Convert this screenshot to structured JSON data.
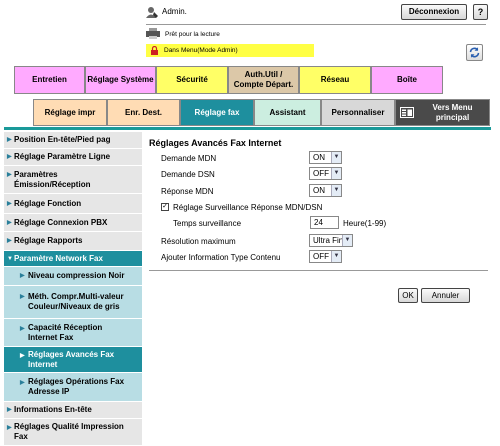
{
  "header": {
    "user_label": "Admin.",
    "logout_label": "Déconnexion",
    "help_label": "?",
    "status_text": "Prêt pour la lecture",
    "mode_text": "Dans Menu(Mode Admin)"
  },
  "main_tabs": [
    {
      "label": "Entretien",
      "color": "#ffaaff"
    },
    {
      "label": "Réglage Système",
      "color": "#ffaaff"
    },
    {
      "label": "Sécurité",
      "color": "#ffff66"
    },
    {
      "label": "Auth.Util / Compte Départ.",
      "color": "#dcc8a8"
    },
    {
      "label": "Réseau",
      "color": "#ffff66"
    },
    {
      "label": "Boîte",
      "color": "#ffaaff"
    }
  ],
  "sub_tabs": [
    {
      "label": "Réglage impr",
      "color": "#ffdcb4"
    },
    {
      "label": "Enr. Dest.",
      "color": "#ffdcb4"
    },
    {
      "label": "Réglage fax",
      "color": "#1e8f9e",
      "active": true
    },
    {
      "label": "Assistant",
      "color": "#cceee0"
    },
    {
      "label": "Personnaliser",
      "color": "#d8d8d8"
    },
    {
      "label": "Vers Menu principal",
      "color": "#4a4a4a"
    }
  ],
  "sidebar": {
    "items": [
      {
        "label": "Position En-tête/Pied pag"
      },
      {
        "label": "Réglage Paramètre Ligne"
      },
      {
        "label": "Paramètres Émission/Réception"
      },
      {
        "label": "Réglage Fonction"
      },
      {
        "label": "Réglage Connexion PBX"
      },
      {
        "label": "Réglage Rapports"
      },
      {
        "label": "Paramètre Network Fax"
      },
      {
        "label": "Informations En-tête"
      },
      {
        "label": "Réglages Qualité Impression Fax"
      }
    ],
    "sub_items": [
      {
        "label": "Niveau compression Noir"
      },
      {
        "label": "Méth. Compr.Multi-valeur Couleur/Niveaux de gris"
      },
      {
        "label": "Capacité Réception Internet Fax"
      },
      {
        "label": "Réglages Avancés Fax Internet"
      },
      {
        "label": "Réglages Opérations Fax Adresse IP"
      }
    ]
  },
  "main": {
    "title": "Réglages Avancés Fax Internet",
    "fields": [
      {
        "label": "Demande MDN",
        "value": "ON"
      },
      {
        "label": "Demande DSN",
        "value": "OFF"
      },
      {
        "label": "Réponse MDN",
        "value": "ON"
      }
    ],
    "checkbox_label": "Réglage Surveillance Réponse MDN/DSN",
    "checkbox_mark": "✓",
    "timeout_label": "Temps surveillance",
    "timeout_value": "24",
    "timeout_unit": "Heure(1-99)",
    "resolution_label": "Résolution maximum",
    "resolution_value": "Ultra Fin",
    "content_type_label": "Ajouter Information Type Contenu",
    "content_type_value": "OFF",
    "ok_label": "OK",
    "cancel_label": "Annuler"
  }
}
